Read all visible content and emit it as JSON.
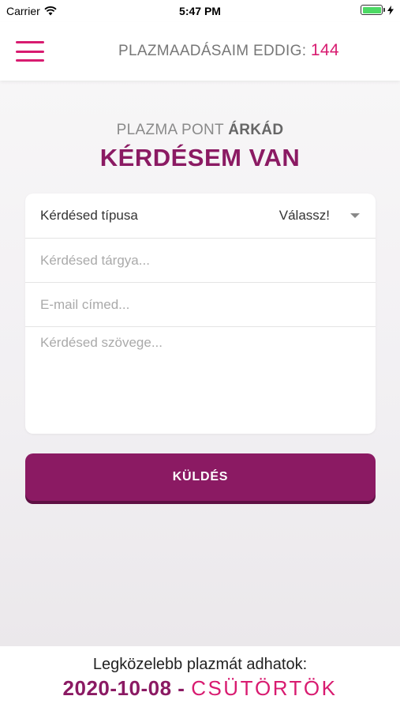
{
  "status_bar": {
    "carrier": "Carrier",
    "time": "5:47 PM",
    "wifi_icon": "wifi-icon",
    "battery_icon": "battery-icon"
  },
  "header": {
    "menu_icon": "hamburger-menu-icon",
    "counter_label": "PLAZMAADÁSAIM EDDIG:",
    "counter_value": "144"
  },
  "main": {
    "location_prefix": "PLAZMA PONT",
    "location_name": "ÁRKÁD",
    "title": "KÉRDÉSEM VAN",
    "form": {
      "type_label": "Kérdésed típusa",
      "type_value": "Válassz!",
      "subject_placeholder": "Kérdésed tárgya...",
      "email_placeholder": "E-mail címed...",
      "text_placeholder": "Kérdésed szövege..."
    },
    "send_label": "KÜLDÉS"
  },
  "footer": {
    "next_label": "Legközelebb plazmát adhatok:",
    "next_date": "2020-10-08",
    "separator": "-",
    "next_day": "CSÜTÖRTÖK"
  },
  "colors": {
    "accent": "#d81b70",
    "brand": "#8b1a63"
  }
}
